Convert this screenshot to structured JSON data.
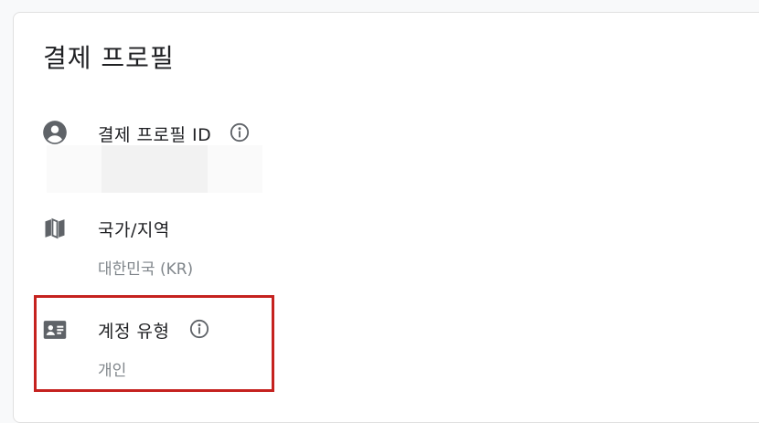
{
  "profile": {
    "title": "결제 프로필",
    "rows": [
      {
        "label": "결제 프로필 ID",
        "icon": "account-circle-icon",
        "value": ""
      },
      {
        "label": "국가/지역",
        "icon": "map-icon",
        "value": "대한민국 (KR)"
      },
      {
        "label": "계정 유형",
        "icon": "contact-card-icon",
        "value": "개인"
      }
    ]
  },
  "colors": {
    "highlight_border": "#c5221f",
    "label_text": "#202124",
    "value_text": "#80868b",
    "icon": "#5f6368"
  }
}
